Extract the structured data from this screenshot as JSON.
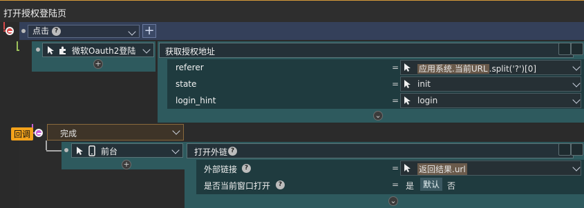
{
  "title": "打开授权登陆页",
  "trigger_click": {
    "label": "点击"
  },
  "wechat_node": {
    "name": "微软Oauth2登陆",
    "action_title": "获取授权地址",
    "fields": [
      {
        "label": "referer",
        "value_parts": [
          "应用系统.当前URL",
          ".split('?')[0]"
        ]
      },
      {
        "label": "state",
        "value": "init"
      },
      {
        "label": "login_hint",
        "value": "login"
      }
    ]
  },
  "callback": {
    "badge": "回调",
    "label": "完成"
  },
  "frontend_node": {
    "name": "前台",
    "action_title": "打开外链",
    "fields": [
      {
        "label": "外部链接",
        "value": "返回结果.url"
      },
      {
        "label": "是否当前窗口打开",
        "opt_yes": "是",
        "opt_default": "默认",
        "opt_no": "否"
      }
    ]
  },
  "misc": {
    "plus_symbol": "+",
    "eq_symbol": "="
  },
  "colors": {
    "accent_orange": "#f3a21b",
    "connector_red": "#d74a4a",
    "connector_green": "#9cc15b",
    "connector_pink": "#c65fd6"
  }
}
